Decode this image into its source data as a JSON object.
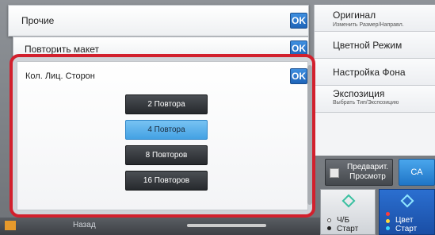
{
  "panels": [
    {
      "title": "Прочие",
      "ok": "OK"
    },
    {
      "title": "Повторить макет",
      "ok": "OK"
    }
  ],
  "right_menu": [
    {
      "label": "Оригинал",
      "sub": "Изменить Размер/Направл."
    },
    {
      "label": "Цветной Режим",
      "sub": ""
    },
    {
      "label": "Настройка Фона",
      "sub": ""
    },
    {
      "label": "Экспозиция",
      "sub": "Выбрать Тип/Экспозицию"
    }
  ],
  "preview_button": {
    "line1": "Предварит.",
    "line2": "Просмотр"
  },
  "ca_button": "CA",
  "start_bw": {
    "line1": "Ч/Б",
    "line2": "Старт"
  },
  "start_color": {
    "line1": "Цвет",
    "line2": "Старт"
  },
  "dialog": {
    "title": "Кол. Лиц. Сторон",
    "ok": "OK",
    "options": [
      {
        "label": "2 Повтора",
        "selected": false
      },
      {
        "label": "4 Повтора",
        "selected": true
      },
      {
        "label": "8 Повторов",
        "selected": false
      },
      {
        "label": "16 Повторов",
        "selected": false
      }
    ]
  },
  "bottom": {
    "back": "Назад"
  },
  "colors": {
    "highlight": "#d2202d",
    "ok_blue": "#1e64b8",
    "selected": "#43a1e3"
  }
}
